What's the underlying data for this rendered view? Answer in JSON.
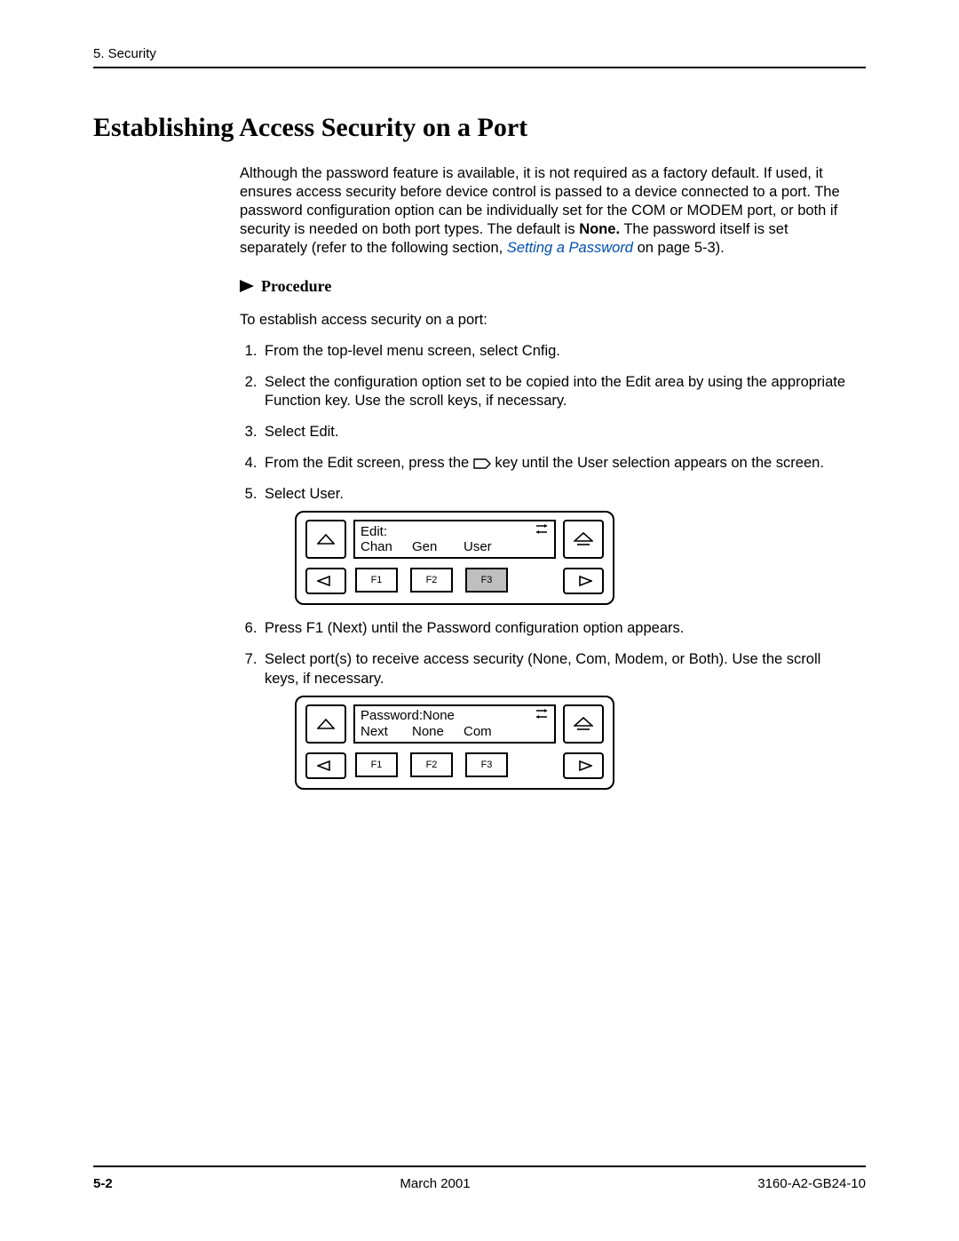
{
  "header": {
    "chapter": "5. Security"
  },
  "title": "Establishing Access Security on a Port",
  "intro": {
    "prefix": "Although the password feature is available, it is not required as a factory default. If used, it ensures access security before device control is passed to a device connected to a port. The password configuration option can be individually set for the COM or MODEM port, or both if security is needed on both port types. The default is ",
    "bold": "None.",
    "mid": " The password itself is set separately (refer to the following section, ",
    "xref": "Setting a Password",
    "suffix": " on page 5-3)."
  },
  "procedure_label": "Procedure",
  "lead": "To establish access security on a port:",
  "steps": {
    "s1": "From the top-level menu screen, select Cnfig.",
    "s2": "Select the configuration option set to be copied into the Edit area by using the appropriate Function key. Use the scroll keys, if necessary.",
    "s3": "Select Edit.",
    "s4a": "From the Edit screen, press the ",
    "s4b": " key until the User selection appears on the screen.",
    "s5": "Select User.",
    "s6": "Press F1 (Next) until the Password configuration option appears.",
    "s7": "Select port(s) to receive access security (None, Com, Modem, or Both). Use the scroll keys, if necessary."
  },
  "panel1": {
    "line1": "Edit:",
    "c1": "Chan",
    "c2": "Gen",
    "c3": "User",
    "f1": "F1",
    "f2": "F2",
    "f3": "F3"
  },
  "panel2": {
    "line1": "Password:None",
    "c1": "Next",
    "c2": "None",
    "c3": "Com",
    "f1": "F1",
    "f2": "F2",
    "f3": "F3"
  },
  "footer": {
    "page": "5-2",
    "date": "March 2001",
    "docnum": "3160-A2-GB24-10"
  }
}
